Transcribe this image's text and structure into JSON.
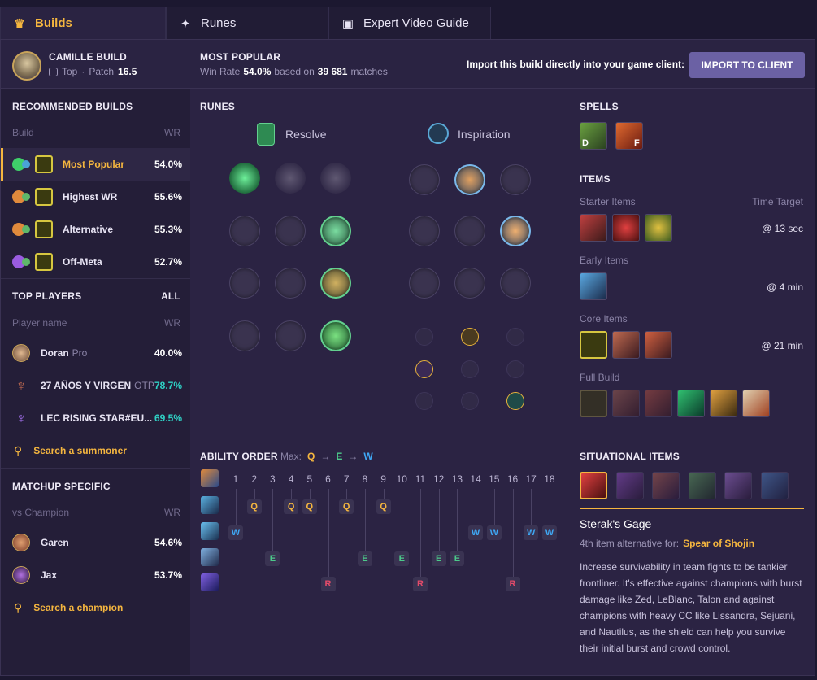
{
  "tabs": [
    {
      "label": "Builds",
      "icon": "builds-icon"
    },
    {
      "label": "Runes",
      "icon": "runes-icon"
    },
    {
      "label": "Expert Video Guide",
      "icon": "video-icon"
    }
  ],
  "header": {
    "champion_build": "CAMILLE BUILD",
    "role": "Top",
    "patch_label": "Patch",
    "patch": "16.5",
    "most_popular": "MOST POPULAR",
    "win_rate_label": "Win Rate",
    "win_rate": "54.0%",
    "based_on": "based on",
    "matches": "39 681",
    "matches_label": "matches",
    "import_text": "Import this build directly into your game client:",
    "import_button": "IMPORT TO CLIENT"
  },
  "recommended": {
    "title": "RECOMMENDED BUILDS",
    "col_build": "Build",
    "col_wr": "WR",
    "items": [
      {
        "label": "Most Popular",
        "wr": "54.0%"
      },
      {
        "label": "Highest WR",
        "wr": "55.6%"
      },
      {
        "label": "Alternative",
        "wr": "55.3%"
      },
      {
        "label": "Off-Meta",
        "wr": "52.7%"
      }
    ]
  },
  "top_players": {
    "title": "TOP PLAYERS",
    "all": "ALL",
    "col_name": "Player name",
    "col_wr": "WR",
    "items": [
      {
        "name": "Doran",
        "tag": "Pro",
        "wr": "40.0%"
      },
      {
        "name": "27 AÑOS Y VIRGEN",
        "tag": "OTP",
        "wr": "78.7%"
      },
      {
        "name": "LEC RISING STAR#EU...",
        "tag": "",
        "wr": "69.5%"
      }
    ],
    "search": "Search a summoner"
  },
  "matchup": {
    "title": "MATCHUP SPECIFIC",
    "col_vs": "vs Champion",
    "col_wr": "WR",
    "items": [
      {
        "name": "Garen",
        "wr": "54.6%"
      },
      {
        "name": "Jax",
        "wr": "53.7%"
      }
    ],
    "search": "Search a champion"
  },
  "runes": {
    "title": "RUNES",
    "primary": "Resolve",
    "secondary": "Inspiration"
  },
  "spells": {
    "title": "SPELLS",
    "keys": [
      "D",
      "F"
    ]
  },
  "items": {
    "title": "ITEMS",
    "starter": "Starter Items",
    "time_target": "Time Target",
    "starter_time": "@ 13 sec",
    "early": "Early Items",
    "early_time": "@ 4 min",
    "core": "Core Items",
    "core_time": "@ 21 min",
    "full": "Full Build"
  },
  "ability": {
    "title": "ABILITY ORDER",
    "max_label": "Max:",
    "max": [
      "Q",
      "E",
      "W"
    ],
    "levels": [
      "1",
      "2",
      "3",
      "4",
      "5",
      "6",
      "7",
      "8",
      "9",
      "10",
      "11",
      "12",
      "13",
      "14",
      "15",
      "16",
      "17",
      "18"
    ]
  },
  "situational": {
    "title": "SITUATIONAL ITEMS",
    "item_name": "Sterak's Gage",
    "alt_label": "4th item alternative for:",
    "alt_item": "Spear of Shojin",
    "description": "Increase survivability in team fights to be tankier frontliner. It's effective against champions with burst damage like Zed, LeBlanc, Talon and against champions with heavy CC like Lissandra, Sejuani, and Nautilus, as the shield can help you survive their initial burst and crowd control."
  },
  "colors": {
    "accent": "#f5b63f",
    "wr_teal": "#2fd0c4",
    "button": "#6b61a4",
    "q": "#f5b63f",
    "w": "#3fa8f5",
    "e": "#4cc98a",
    "r": "#e34b6a"
  }
}
